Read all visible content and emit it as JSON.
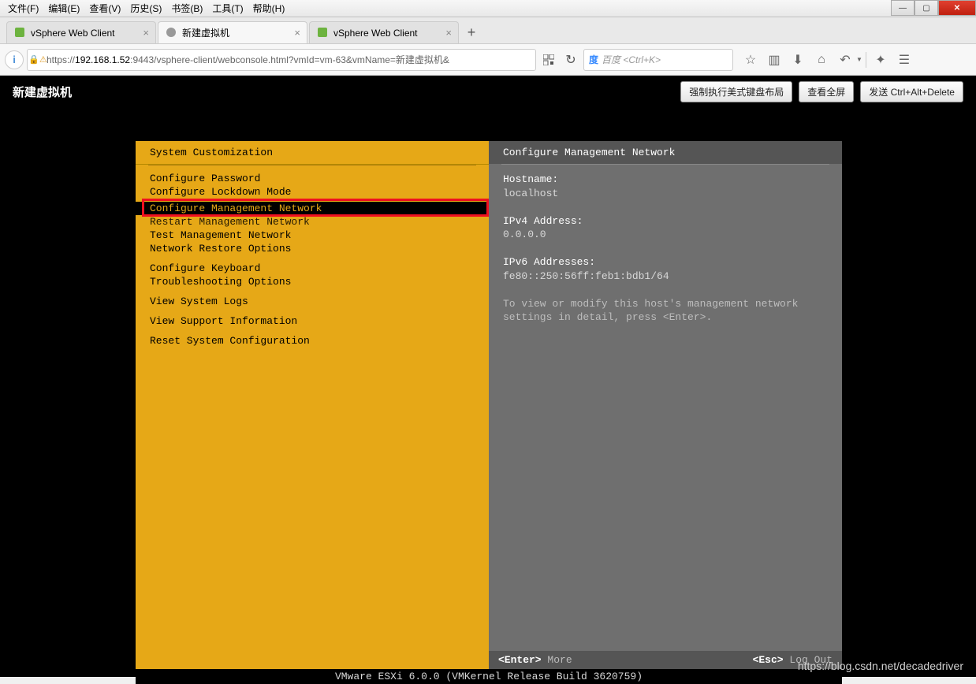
{
  "browser": {
    "menu": [
      "文件(F)",
      "编辑(E)",
      "查看(V)",
      "历史(S)",
      "书签(B)",
      "工具(T)",
      "帮助(H)"
    ],
    "tabs": [
      {
        "title": "vSphere Web Client",
        "fav": "green",
        "active": false
      },
      {
        "title": "新建虚拟机",
        "fav": "grey",
        "active": true
      },
      {
        "title": "vSphere Web Client",
        "fav": "green",
        "active": false
      }
    ],
    "url_prefix": "https://",
    "url_host": "192.168.1.52",
    "url_rest": ":9443/vsphere-client/webconsole.html?vmId=vm-63&vmName=新建虚拟机&",
    "search_engine": "度",
    "search_placeholder": "百度 <Ctrl+K>"
  },
  "console": {
    "title": "新建虚拟机",
    "buttons": [
      "强制执行美式键盘布局",
      "查看全屏",
      "发送 Ctrl+Alt+Delete"
    ]
  },
  "dcui": {
    "left_title": "System Customization",
    "right_title": "Configure Management Network",
    "menu_groups": [
      [
        "Configure Password",
        "Configure Lockdown Mode"
      ],
      [
        "__SELECTED__Configure Management Network",
        "Restart Management Network",
        "Test Management Network",
        "Network Restore Options"
      ],
      [
        "Configure Keyboard",
        "Troubleshooting Options"
      ],
      [
        "View System Logs"
      ],
      [
        "View Support Information"
      ],
      [
        "Reset System Configuration"
      ]
    ],
    "details": {
      "hostname_label": "Hostname:",
      "hostname": "localhost",
      "ipv4_label": "IPv4 Address:",
      "ipv4": "0.0.0.0",
      "ipv6_label": "IPv6 Addresses:",
      "ipv6": "fe80::250:56ff:feb1:bdb1/64",
      "hint": "To view or modify this host's management network settings in detail, press <Enter>."
    },
    "footer": {
      "enter_key": "<Enter>",
      "enter_txt": "More",
      "esc_key": "<Esc>",
      "esc_txt": "Log Out"
    },
    "version": "VMware ESXi 6.0.0 (VMKernel Release Build 3620759)"
  },
  "watermark": "https://blog.csdn.net/decadedriver"
}
